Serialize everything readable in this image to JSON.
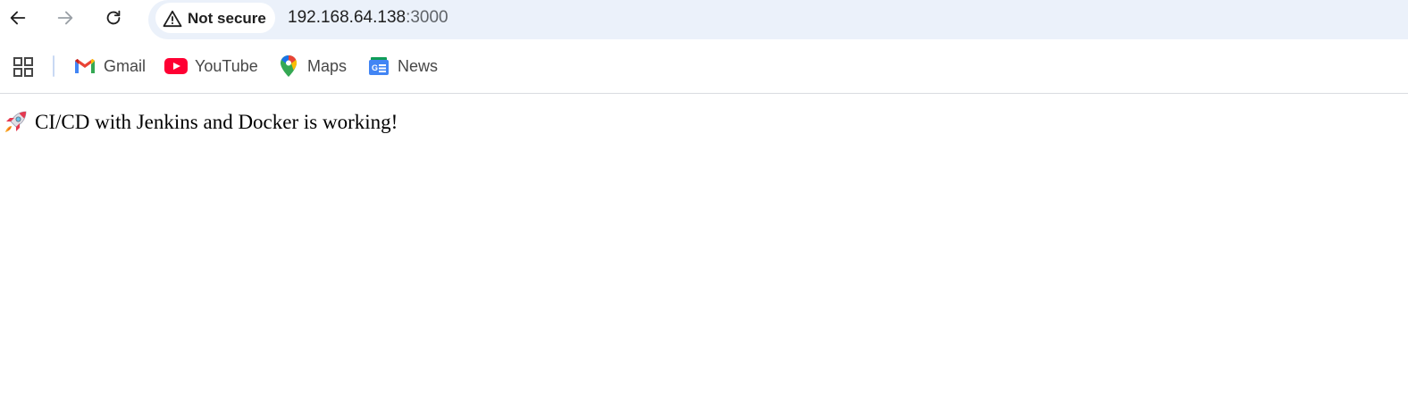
{
  "browser": {
    "security_label": "Not secure",
    "url_host": "192.168.64.138",
    "url_port": ":3000",
    "nav": {
      "back_icon": "arrow-left-icon",
      "forward_icon": "arrow-right-icon",
      "reload_icon": "reload-icon"
    }
  },
  "bookmarks": [
    {
      "label": "Gmail",
      "icon": "gmail-icon"
    },
    {
      "label": "YouTube",
      "icon": "youtube-icon"
    },
    {
      "label": "Maps",
      "icon": "maps-icon"
    },
    {
      "label": "News",
      "icon": "news-icon"
    }
  ],
  "page": {
    "emoji": "rocket-icon",
    "message": "CI/CD with Jenkins and Docker is working!"
  },
  "colors": {
    "omnibox_bg": "#ebf1fa",
    "youtube_red": "#ff0033",
    "text_dark": "#1f1f1f"
  }
}
